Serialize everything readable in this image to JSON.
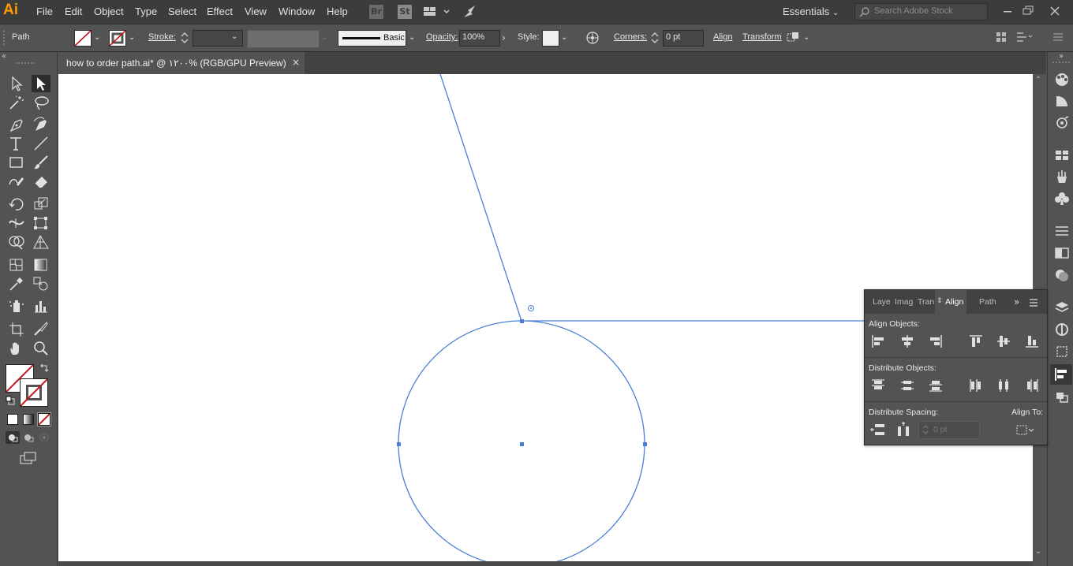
{
  "app": {
    "logo": "Ai",
    "menu": [
      "File",
      "Edit",
      "Object",
      "Type",
      "Select",
      "Effect",
      "View",
      "Window",
      "Help"
    ],
    "bridge_label": "Br",
    "stock_label": "St",
    "workspace": "Essentials",
    "search_placeholder": "Search Adobe Stock",
    "window_controls": [
      "minimize-icon",
      "restore-icon",
      "close-icon"
    ]
  },
  "control_bar": {
    "selection_type": "Path",
    "stroke_label": "Stroke:",
    "stroke_weight": "",
    "brush_label": "Basic",
    "opacity_label": "Opacity:",
    "opacity_value": "100%",
    "style_label": "Style:",
    "corners_label": "Corners:",
    "corners_value": "0 pt",
    "align_label": "Align",
    "transform_label": "Transform"
  },
  "document": {
    "tab_title": "how to order path.ai* @ ۱۲۰۰% (RGB/GPU Preview)",
    "close_glyph": "×"
  },
  "tools": [
    "selection-tool",
    "direct-selection-tool",
    "magic-wand-tool",
    "lasso-tool",
    "pen-tool",
    "curvature-tool",
    "type-tool",
    "line-segment-tool",
    "rectangle-tool",
    "paintbrush-tool",
    "shaper-tool",
    "eraser-tool",
    "rotate-tool",
    "scale-tool",
    "width-tool",
    "free-transform-tool",
    "shape-builder-tool",
    "perspective-grid-tool",
    "mesh-tool",
    "gradient-tool",
    "eyedropper-tool",
    "blend-tool",
    "symbol-sprayer-tool",
    "column-graph-tool",
    "artboard-tool",
    "slice-tool",
    "hand-tool",
    "zoom-tool"
  ],
  "colors": {
    "ui_dark": "#3c3c3c",
    "ui_mid": "#535353",
    "path_blue": "#4a7fd4",
    "none_red": "#c4161c",
    "logo_orange": "#ff9a00"
  },
  "align_panel": {
    "tabs": [
      "Laye",
      "Imag",
      "Tran",
      "Align",
      "Path"
    ],
    "active_tab": "Align",
    "align_objects_label": "Align Objects:",
    "distribute_objects_label": "Distribute Objects:",
    "distribute_spacing_label": "Distribute Spacing:",
    "align_to_label": "Align To:",
    "spacing_value": "0 pt"
  }
}
